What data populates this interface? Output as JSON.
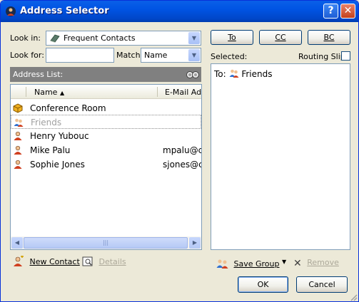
{
  "window": {
    "title": "Address Selector",
    "help_label": "?",
    "close_label": "✕"
  },
  "look_in": {
    "label": "Look in:",
    "value": "Frequent Contacts"
  },
  "look_for": {
    "label": "Look for:",
    "value": "",
    "match_label": "Match",
    "match_value": "Name"
  },
  "recipient_buttons": {
    "to": "To",
    "cc": "CC",
    "bc": "BC"
  },
  "selected": {
    "label": "Selected:",
    "routing_slip_label": "Routing Slip",
    "routing_slip_checked": false,
    "to_prefix": "To:",
    "recipient": "Friends"
  },
  "address_list": {
    "title": "Address List:",
    "columns": [
      "Name",
      "E-Mail Add"
    ],
    "rows": [
      {
        "icon": "resource-icon",
        "name": "Conference Room",
        "email": ""
      },
      {
        "icon": "group-icon",
        "name": "Friends",
        "email": ""
      },
      {
        "icon": "contact-icon",
        "name": "Henry Yubouc",
        "email": ""
      },
      {
        "icon": "contact-icon",
        "name": "Mike Palu",
        "email": "mpalu@cc"
      },
      {
        "icon": "contact-icon",
        "name": "Sophie Jones",
        "email": "sjones@c"
      }
    ]
  },
  "bottom_left": {
    "new_contact": "New Contact",
    "details": "Details"
  },
  "bottom_right": {
    "save_group": "Save Group",
    "remove": "Remove",
    "ok": "OK",
    "cancel": "Cancel"
  }
}
